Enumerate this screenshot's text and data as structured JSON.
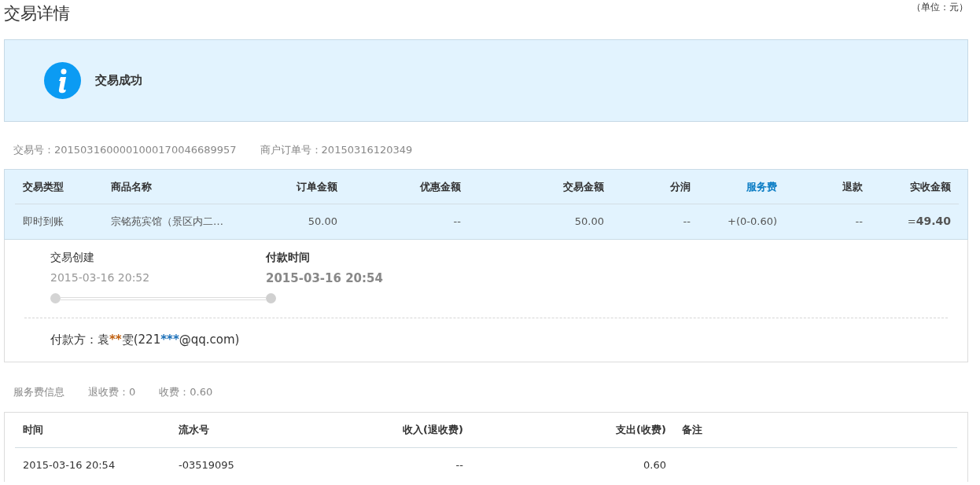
{
  "title": "交易详情",
  "unit_note": "（单位：元）",
  "status": {
    "text": "交易成功"
  },
  "ids": [
    {
      "label": "交易号：",
      "value": "2015031600001000170046689957"
    },
    {
      "label": "商户订单号：",
      "value": "20150316120349"
    }
  ],
  "trade_table": {
    "columns": [
      {
        "label": "交易类型",
        "kind": "text"
      },
      {
        "label": "商品名称",
        "kind": "text"
      },
      {
        "label": "订单金额",
        "kind": "amount"
      },
      {
        "label": "优惠金额",
        "kind": "amount"
      },
      {
        "label": "交易金额",
        "kind": "amount"
      },
      {
        "label": "分润",
        "kind": "amount"
      },
      {
        "label": "服务费",
        "kind": "link"
      },
      {
        "label": "退款",
        "kind": "amount"
      },
      {
        "label": "实收金额",
        "kind": "amount"
      }
    ],
    "rows": [
      {
        "cells": [
          {
            "text": "即时到账",
            "kind": "plain"
          },
          {
            "text": "宗铭苑宾馆（景区内二…",
            "kind": "plain"
          },
          {
            "text": "50.00",
            "kind": "plain"
          },
          {
            "text": "--",
            "kind": "plain"
          },
          {
            "text": "50.00",
            "kind": "plain"
          },
          {
            "text": "--",
            "kind": "plain"
          },
          {
            "text": "+(0-0.60)",
            "kind": "plain"
          },
          {
            "text": "--",
            "kind": "plain"
          },
          {
            "text": "=",
            "kind": "total",
            "amount": "49.40"
          }
        ]
      }
    ]
  },
  "timeline": {
    "steps": [
      {
        "label": "交易创建",
        "time": "2015-03-16 20:52",
        "current": false
      },
      {
        "label": "付款时间",
        "time": "2015-03-16 20:54",
        "current": true
      }
    ]
  },
  "payer": {
    "label": "付款方：",
    "parts": [
      {
        "text": "袁",
        "color": "#333333",
        "kind": "plain"
      },
      {
        "text": "**",
        "color": "#c06010",
        "kind": "mask"
      },
      {
        "text": "雯(221",
        "color": "#333333",
        "kind": "plain"
      },
      {
        "text": "***",
        "color": "#1a6fb8",
        "kind": "mask"
      },
      {
        "text": "@qq.com)",
        "color": "#333333",
        "kind": "plain"
      }
    ]
  },
  "fee_info": [
    {
      "text": "服务费信息"
    },
    {
      "text": "退收费：0"
    },
    {
      "text": "收费：0.60"
    }
  ],
  "fee_table": {
    "columns": [
      {
        "label": "时间",
        "kind": "text"
      },
      {
        "label": "流水号",
        "kind": "text"
      },
      {
        "label": "收入(退收费)",
        "kind": "amount"
      },
      {
        "label": "支出(收费)",
        "kind": "amount"
      },
      {
        "label": "备注",
        "kind": "text"
      }
    ],
    "rows": [
      {
        "cells": [
          "2015-03-16 20:54",
          "-03519095",
          "--",
          "0.60"
        ]
      }
    ]
  }
}
